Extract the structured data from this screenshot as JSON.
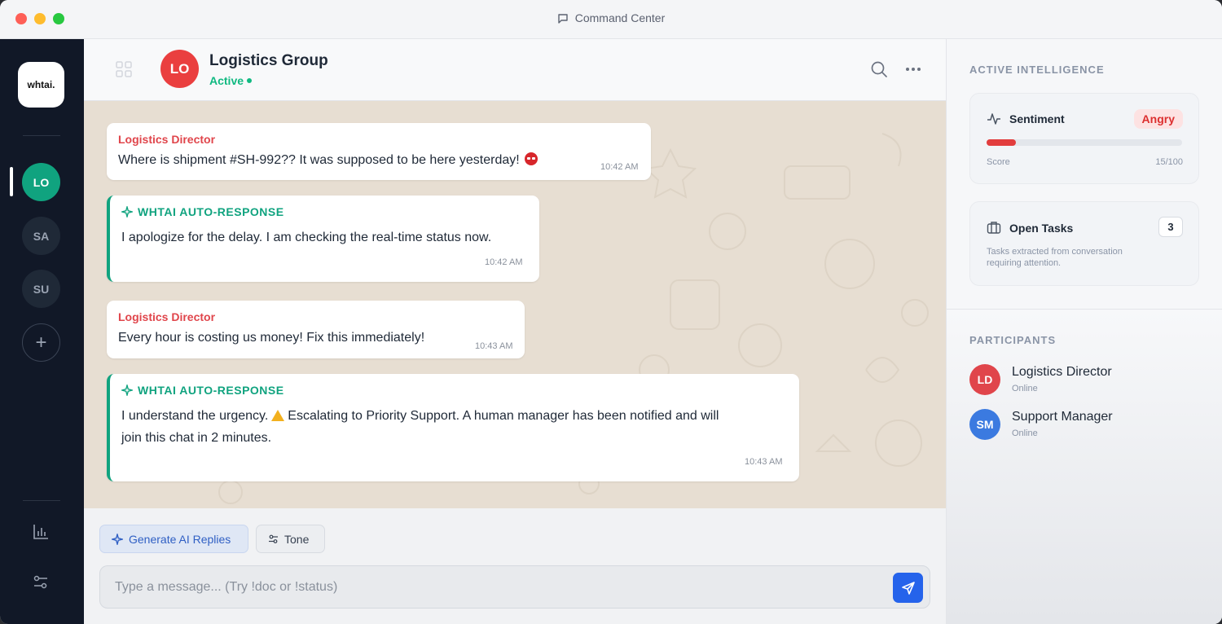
{
  "window": {
    "title": "Command Center"
  },
  "rail": {
    "logo": "whtai.",
    "items": [
      {
        "label": "LO"
      },
      {
        "label": "SA"
      },
      {
        "label": "SU"
      }
    ],
    "add_label": "+"
  },
  "chat": {
    "avatar": "LO",
    "title": "Logistics Group",
    "status": "Active",
    "messages": [
      {
        "sender": "Logistics Director",
        "text": "Where is shipment #SH-992?? It was supposed to be here yesterday!",
        "time": "10:42 AM"
      },
      {
        "sender": "WHTAI AUTO-RESPONSE",
        "text": "I apologize for the delay. I am checking the real-time status now.",
        "time": "10:42 AM"
      },
      {
        "sender": "Logistics Director",
        "text": "Every hour is costing us money! Fix this immediately!",
        "time": "10:43 AM"
      },
      {
        "sender": "WHTAI AUTO-RESPONSE",
        "text_a": "I understand the urgency.",
        "text_b": "Escalating to Priority Support. A human manager has been notified and will",
        "text_c": "join this chat in 2 minutes.",
        "time": "10:43 AM"
      }
    ]
  },
  "composer": {
    "generate_label": "Generate AI Replies",
    "tone_label": "Tone",
    "placeholder": "Type a message... (Try !doc or !status)"
  },
  "intel": {
    "section_title": "ACTIVE INTELLIGENCE",
    "sentiment": {
      "title": "Sentiment",
      "badge": "Angry",
      "score_label": "Score",
      "score_value": "15/100",
      "score_fraction": 0.15
    },
    "tasks": {
      "title": "Open Tasks",
      "count": "3",
      "description_1": "Tasks extracted from conversation",
      "description_2": "requiring attention."
    }
  },
  "participants": {
    "section_title": "PARTICIPANTS",
    "list": [
      {
        "initials": "LD",
        "name": "Logistics Director",
        "status": "Online",
        "color": "#e0454b"
      },
      {
        "initials": "SM",
        "name": "Support Manager",
        "status": "Online",
        "color": "#3b7ae0"
      }
    ]
  },
  "colors": {
    "accent_green": "#10a37f",
    "danger": "#e23d3d",
    "primary_blue": "#2563eb"
  }
}
